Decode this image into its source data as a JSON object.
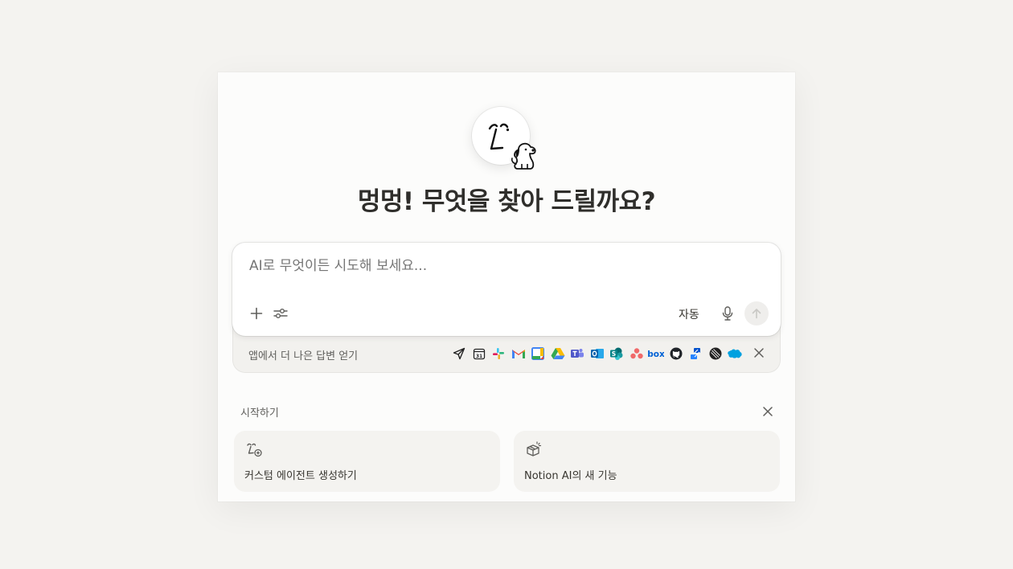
{
  "heading": "멍멍! 무엇을 찾아 드릴까요?",
  "composer": {
    "placeholder": "AI로 무엇이든 시도해 보세요...",
    "mode_label": "자동"
  },
  "apps_bar": {
    "label": "앱에서 더 나은 답변 얻기",
    "apps": [
      "send-icon",
      "calendar-icon",
      "slack-icon",
      "gmail-icon",
      "google-calendar-icon",
      "google-drive-icon",
      "teams-icon",
      "outlook-icon",
      "sharepoint-icon",
      "asana-icon",
      "box-icon",
      "github-icon",
      "jira-icon",
      "linear-icon",
      "salesforce-icon"
    ]
  },
  "getting_started": {
    "label": "시작하기",
    "cards": [
      {
        "label": "커스텀 에이전트 생성하기",
        "icon": "agent-plus-icon"
      },
      {
        "label": "Notion AI의 새 기능",
        "icon": "gift-box-icon"
      }
    ]
  },
  "colors": {
    "background": "#f4f3f0",
    "panel": "#fcfcfb",
    "text": "#37352f",
    "muted": "#9b9a97"
  }
}
